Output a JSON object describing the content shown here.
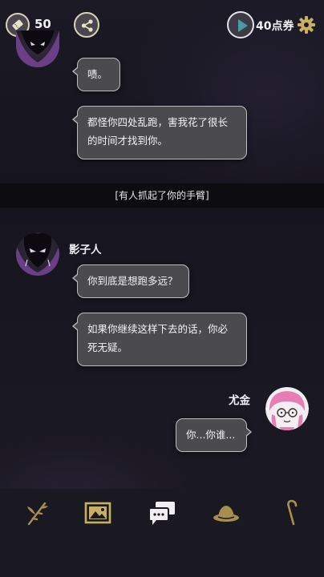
{
  "topbar": {
    "coin_count": "50",
    "ticket_label": "40点券"
  },
  "chat": {
    "messages_top": [
      {
        "text": "啧。"
      },
      {
        "text_line1": "都怪你四处乱跑，害我花了很长",
        "text_line2": "的时间才找到你。"
      }
    ],
    "narration": "[有人抓起了你的手臂]",
    "shadow_speaker": "影子人",
    "shadow_msg1": "你到底是想跑多远？",
    "shadow_msg2_line1": "如果你继续这样下去的话，你必",
    "shadow_msg2_line2": "死无疑。",
    "yujin_speaker": "尤金",
    "yujin_msg": "你...你谁..."
  },
  "nav": {
    "items": [
      {
        "icon": "bamboo-icon"
      },
      {
        "icon": "gallery-icon"
      },
      {
        "icon": "chat-icon"
      },
      {
        "icon": "hat-icon"
      },
      {
        "icon": "cane-icon"
      }
    ]
  },
  "colors": {
    "accent_gold": "#c9b061",
    "bubble_bg": "#4b4b4f",
    "play_teal": "#4c98a6"
  }
}
